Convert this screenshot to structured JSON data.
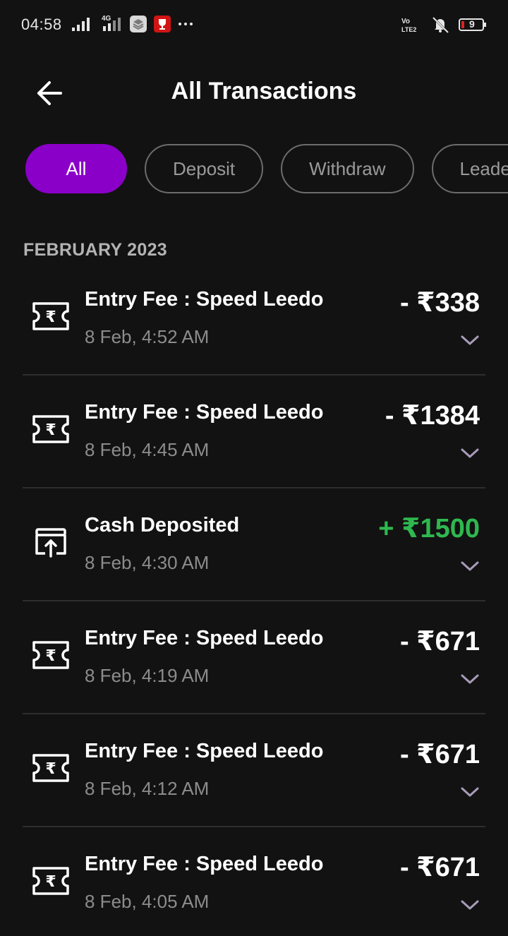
{
  "status_bar": {
    "time": "04:58",
    "network_label": "4G",
    "battery": "9"
  },
  "header": {
    "title": "All Transactions"
  },
  "filters": [
    {
      "label": "All",
      "active": true
    },
    {
      "label": "Deposit",
      "active": false
    },
    {
      "label": "Withdraw",
      "active": false
    },
    {
      "label": "Leaderboard",
      "active": false
    }
  ],
  "month_header": "FEBRUARY 2023",
  "transactions": [
    {
      "icon": "ticket-rupee-icon",
      "title": "Entry Fee : Speed Leedo",
      "time": "8 Feb, 4:52 AM",
      "amount": "- ₹338",
      "type": "debit"
    },
    {
      "icon": "ticket-rupee-icon",
      "title": "Entry Fee : Speed Leedo",
      "time": "8 Feb, 4:45 AM",
      "amount": "- ₹1384",
      "type": "debit"
    },
    {
      "icon": "deposit-icon",
      "title": "Cash Deposited",
      "time": "8 Feb, 4:30 AM",
      "amount": "+ ₹1500",
      "type": "credit"
    },
    {
      "icon": "ticket-rupee-icon",
      "title": "Entry Fee : Speed Leedo",
      "time": "8 Feb, 4:19 AM",
      "amount": "- ₹671",
      "type": "debit"
    },
    {
      "icon": "ticket-rupee-icon",
      "title": "Entry Fee : Speed Leedo",
      "time": "8 Feb, 4:12 AM",
      "amount": "- ₹671",
      "type": "debit"
    },
    {
      "icon": "ticket-rupee-icon",
      "title": "Entry Fee : Speed Leedo",
      "time": "8 Feb, 4:05 AM",
      "amount": "- ₹671",
      "type": "debit"
    }
  ],
  "colors": {
    "background": "#121212",
    "accent": "#8b00c9",
    "credit": "#2eb84f",
    "debit": "#ffffff",
    "muted": "#8c8c8c"
  }
}
